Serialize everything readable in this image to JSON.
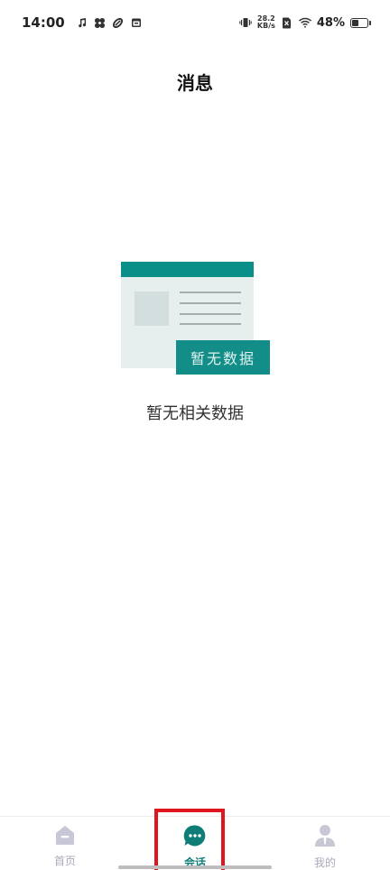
{
  "status_bar": {
    "time": "14:00",
    "net_speed_value": "28.2",
    "net_speed_unit": "KB/s",
    "battery_percent": "48%",
    "battery_level": 0.48,
    "icons": [
      "music-note-icon",
      "fan-icon",
      "link-icon",
      "calendar-icon",
      "vibrate-icon",
      "no-sim-icon",
      "wifi-icon",
      "battery-icon"
    ]
  },
  "header": {
    "title": "消息"
  },
  "empty_state": {
    "illustration_tag": "暂无数据",
    "message": "暂无相关数据"
  },
  "bottom_nav": {
    "items": [
      {
        "label": "首页",
        "icon": "home-icon",
        "active": false
      },
      {
        "label": "会话",
        "icon": "chat-bubble-icon",
        "active": true
      },
      {
        "label": "我的",
        "icon": "person-icon",
        "active": false
      }
    ]
  },
  "colors": {
    "accent": "#0e7d77",
    "illustration_bar": "#0a8f88",
    "inactive": "#a9a9bb",
    "highlight_box": "#e0161e"
  }
}
